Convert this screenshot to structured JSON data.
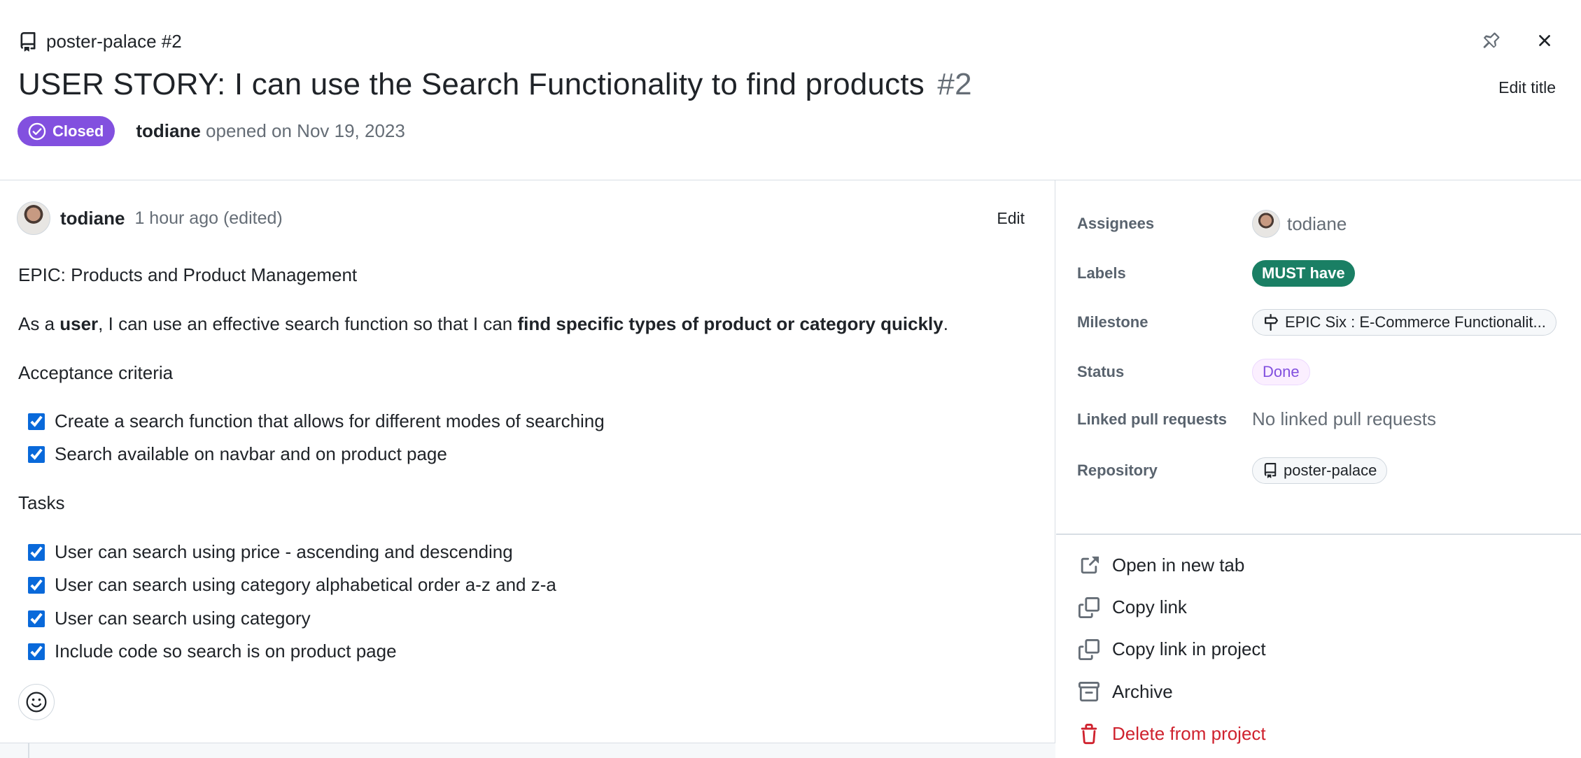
{
  "header": {
    "repo_ref": "poster-palace #2",
    "title": "USER STORY: I can use the Search Functionality to find products",
    "number": "#2",
    "edit_title": "Edit title",
    "state": "Closed",
    "author": "todiane",
    "opened_text": "opened on Nov 19, 2023"
  },
  "comment": {
    "author": "todiane",
    "time": "1 hour ago (edited)",
    "edit_label": "Edit",
    "epic_line": "EPIC: Products and Product Management",
    "story": {
      "prefix": "As a ",
      "bold1": "user",
      "middle": ", I can use an effective search function so that I can ",
      "bold2": "find specific types of product or category quickly",
      "suffix": "."
    },
    "acceptance_heading": "Acceptance criteria",
    "acceptance_items": [
      "Create a search function that allows for different modes of searching",
      "Search available on navbar and on product page"
    ],
    "tasks_heading": "Tasks",
    "task_items": [
      "User can search using price - ascending and descending",
      "User can search using category alphabetical order a-z and z-a",
      "User can search using category",
      "Include code so search is on product page"
    ]
  },
  "sidebar": {
    "fields": [
      {
        "label": "Assignees",
        "value": "todiane"
      },
      {
        "label": "Labels",
        "value": "MUST have"
      },
      {
        "label": "Milestone",
        "value": "EPIC Six : E-Commerce Functionalit..."
      },
      {
        "label": "Status",
        "value": "Done"
      },
      {
        "label": "Linked pull requests",
        "value": "No linked pull requests"
      },
      {
        "label": "Repository",
        "value": "poster-palace"
      }
    ],
    "actions": [
      {
        "label": "Open in new tab"
      },
      {
        "label": "Copy link"
      },
      {
        "label": "Copy link in project"
      },
      {
        "label": "Archive"
      },
      {
        "label": "Delete from project"
      }
    ]
  },
  "colors": {
    "closed_badge": "#8250df",
    "must_have_label": "#1a7f64",
    "done_status": "#8250df",
    "danger": "#cf222e"
  }
}
